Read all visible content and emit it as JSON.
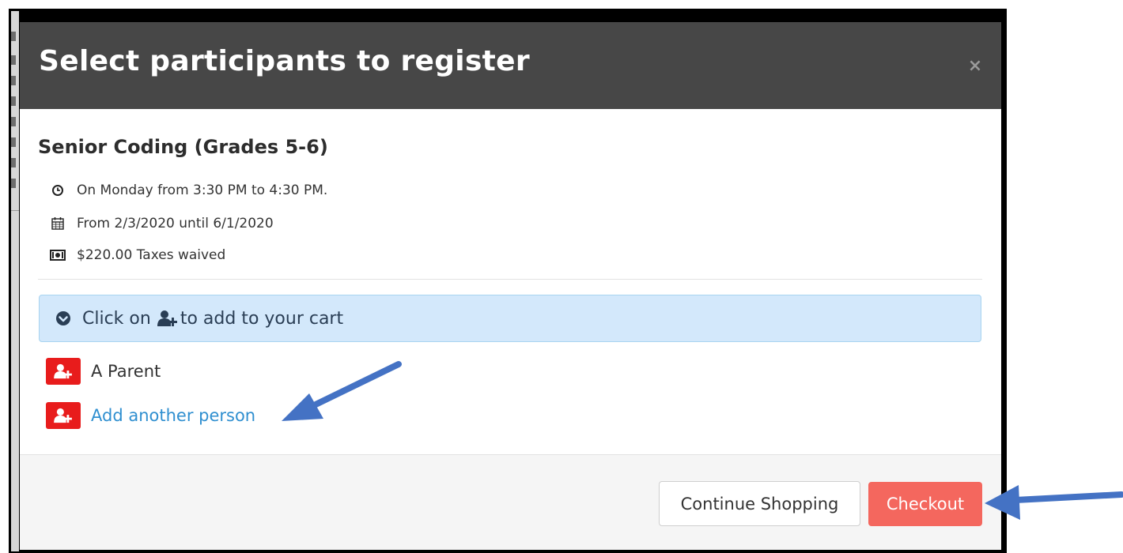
{
  "modal": {
    "title": "Select participants to register",
    "close_label": "×"
  },
  "program": {
    "name": "Senior Coding (Grades 5-6)",
    "details": [
      {
        "icon": "clock-icon",
        "text": "On Monday from 3:30 PM to 4:30 PM."
      },
      {
        "icon": "calendar-icon",
        "text": "From 2/3/2020 until 6/1/2020"
      },
      {
        "icon": "money-icon",
        "text": "$220.00 Taxes waived"
      }
    ]
  },
  "info_bar": {
    "prefix": "Click on",
    "suffix": "to add to your cart"
  },
  "participants": [
    {
      "label": "A Parent",
      "is_link": false
    },
    {
      "label": "Add another person",
      "is_link": true
    }
  ],
  "footer": {
    "continue_label": "Continue Shopping",
    "checkout_label": "Checkout"
  },
  "colors": {
    "header_bg": "#474747",
    "add_button": "#e81c1c",
    "checkout": "#f4675e",
    "link": "#2f8fd0",
    "info_bg": "#d3e8fb",
    "annotation_arrow": "#4472c4"
  }
}
